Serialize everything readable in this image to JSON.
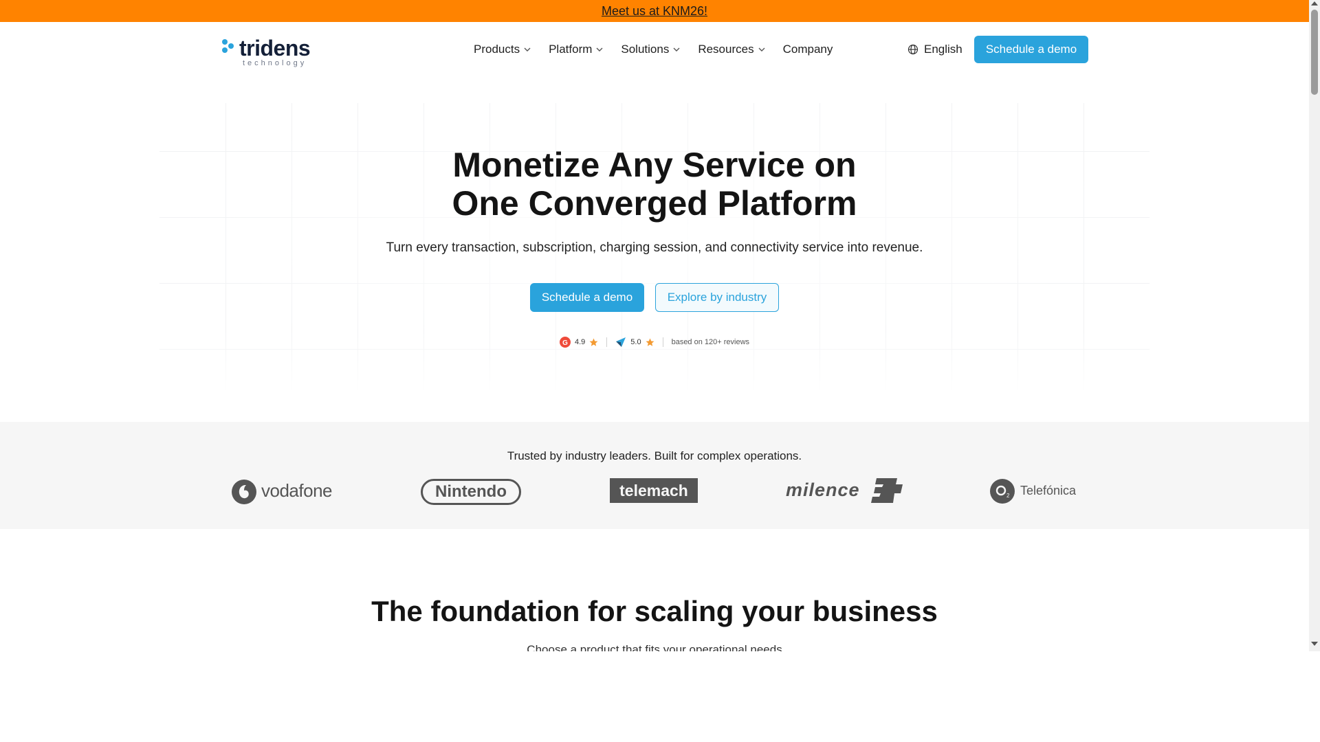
{
  "announcement": {
    "text": "Meet us at KNM26!"
  },
  "brand": {
    "name": "tridens",
    "tagline": "technology",
    "primary_color": "#2aa3dc",
    "accent_color": "#ff8300"
  },
  "nav": {
    "items": [
      {
        "label": "Products",
        "has_dropdown": true
      },
      {
        "label": "Platform",
        "has_dropdown": true
      },
      {
        "label": "Solutions",
        "has_dropdown": true
      },
      {
        "label": "Resources",
        "has_dropdown": true
      },
      {
        "label": "Company",
        "has_dropdown": false
      }
    ],
    "language": "English",
    "cta": "Schedule a demo"
  },
  "hero": {
    "title_line1": "Monetize Any Service on",
    "title_line2": "One Converged Platform",
    "subtitle": "Turn every transaction, subscription, charging session, and connectivity service into revenue.",
    "primary_button": "Schedule a demo",
    "secondary_button": "Explore by industry",
    "ratings": [
      {
        "platform_icon": "g2-icon",
        "score": "4.9"
      },
      {
        "platform_icon": "capterra-icon",
        "score": "5.0"
      }
    ],
    "reviews_note": "based on 120+ reviews"
  },
  "trusted": {
    "text": "Trusted by industry leaders. Built for complex operations.",
    "logos": [
      "vodafone",
      "Nintendo",
      "telemach",
      "milence",
      "Telefónica"
    ]
  },
  "foundation": {
    "title": "The foundation for scaling your business",
    "subtitle": "Choose a product that fits your operational needs"
  }
}
